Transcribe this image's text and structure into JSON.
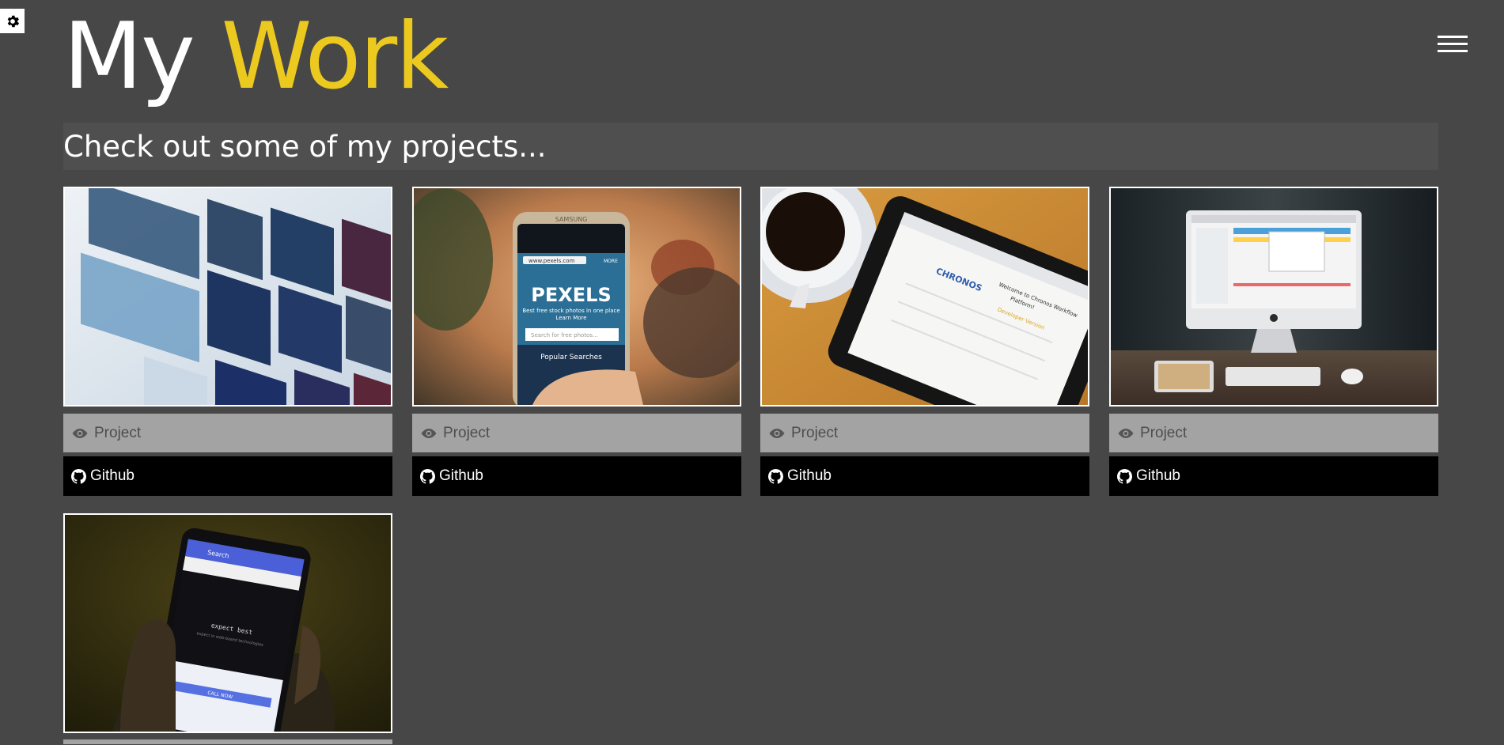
{
  "header": {
    "title_part1": "My",
    "title_part2": "Work",
    "accent_color": "#ecc91f",
    "settings_icon": "gear-icon",
    "menu_icon": "hamburger-menu-icon"
  },
  "intro": {
    "text": "Check out some of my projects..."
  },
  "projects": [
    {
      "image": "streaming-app-tiles-photo",
      "project_label": "Project",
      "github_label": "Github"
    },
    {
      "image": "phone-pexels-website-photo",
      "project_label": "Project",
      "github_label": "Github"
    },
    {
      "image": "tablet-and-coffee-photo",
      "project_label": "Project",
      "github_label": "Github"
    },
    {
      "image": "imac-desk-setup-photo",
      "project_label": "Project",
      "github_label": "Github"
    },
    {
      "image": "phone-in-hand-dark-photo"
    }
  ],
  "tablet_screen_text": {
    "brand": "CHRONOS",
    "line1": "Welcome to Chronos Workflow",
    "line2": "Platform!",
    "line3": "Developer Version"
  },
  "phone_screen_text": {
    "url": "www.pexels.com",
    "more": "MORE",
    "logo": "PEXELS",
    "tagline": "Best free stock photos in one place",
    "learn": "Learn More",
    "search": "Search for free photos...",
    "popular": "Popular Searches",
    "brand": "SAMSUNG"
  },
  "dark_phone_text": {
    "search": "Search",
    "tagline": "expect best",
    "sub": "expect in web-based technologies",
    "cta": "CALL NOW"
  }
}
